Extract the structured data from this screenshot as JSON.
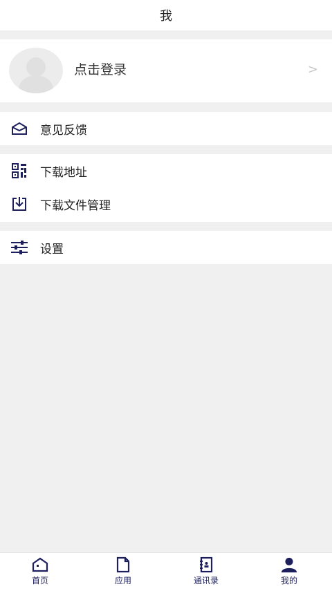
{
  "header": {
    "title": "我"
  },
  "profile": {
    "login_text": "点击登录",
    "chevron": ">"
  },
  "menu": {
    "feedback": "意见反馈",
    "download_address": "下载地址",
    "download_manage": "下载文件管理",
    "settings": "设置"
  },
  "tabs": [
    {
      "label": "首页",
      "icon": "home-icon"
    },
    {
      "label": "应用",
      "icon": "document-icon"
    },
    {
      "label": "通讯录",
      "icon": "contacts-icon"
    },
    {
      "label": "我的",
      "icon": "user-icon"
    }
  ],
  "colors": {
    "accent": "#1c1f5c",
    "background": "#f0f0f0"
  }
}
